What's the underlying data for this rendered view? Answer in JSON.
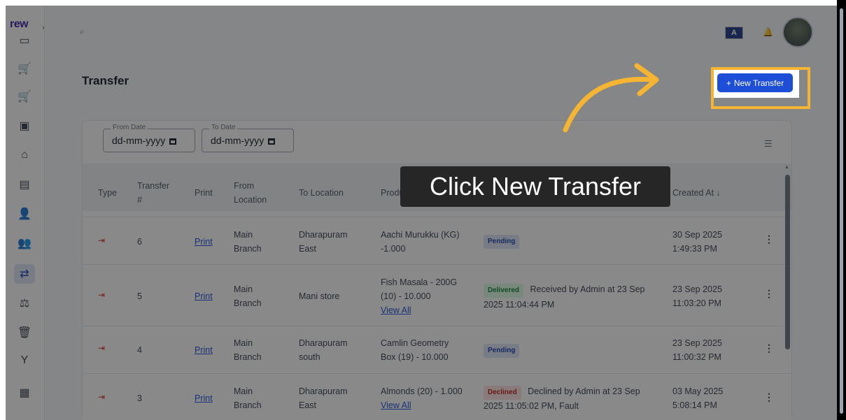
{
  "app": {
    "logo_text": "rew",
    "expand_chevron": "›"
  },
  "topbar": {
    "search_icon": "search-icon",
    "flag_label": "A",
    "bell_icon": "bell-icon"
  },
  "page": {
    "title": "Transfer",
    "new_transfer_label": "New Transfer",
    "new_transfer_plus": "+"
  },
  "filters": {
    "from_date_legend": "From Date",
    "from_date_value": "dd-mm-yyyy",
    "to_date_legend": "To Date",
    "to_date_value": "dd-mm-yyyy"
  },
  "table": {
    "headers": {
      "type": "Type",
      "transfer_no": "Transfer #",
      "print": "Print",
      "from_location": "From Location",
      "to_location": "To Location",
      "product": "Product (Qty)",
      "created_at": "Created At ↓"
    },
    "rows": [
      {
        "transfer_no": "6",
        "print": "Print",
        "from_l1": "Main",
        "from_l2": "Branch",
        "to_l1": "Dharapuram",
        "to_l2": "East",
        "prod_l1": "Aachi Murukku (KG)",
        "prod_l2": "-1.000",
        "prod_link": "",
        "badge": "Pending",
        "status_l1": "",
        "status_l2": "",
        "created_l1": "30 Sep 2025",
        "created_l2": "1:49:33 PM"
      },
      {
        "transfer_no": "5",
        "print": "Print",
        "from_l1": "Main",
        "from_l2": "Branch",
        "to_l1": "Mani store",
        "to_l2": "",
        "prod_l1": "Fish Masala - 200G",
        "prod_l2": "(10) - 10.000",
        "prod_link": "View All",
        "badge": "Delivered",
        "status_l1": "Received by Admin at 23 Sep",
        "status_l2": "2025 11:04:44 PM",
        "created_l1": "23 Sep 2025",
        "created_l2": "11:03:20 PM"
      },
      {
        "transfer_no": "4",
        "print": "Print",
        "from_l1": "Main",
        "from_l2": "Branch",
        "to_l1": "Dharapuram",
        "to_l2": "south",
        "prod_l1": "Camlin Geometry",
        "prod_l2": "Box (19) - 10.000",
        "prod_link": "",
        "badge": "Pending",
        "status_l1": "",
        "status_l2": "",
        "created_l1": "23 Sep 2025",
        "created_l2": "11:00:32 PM"
      },
      {
        "transfer_no": "3",
        "print": "Print",
        "from_l1": "Main",
        "from_l2": "Branch",
        "to_l1": "Dharapuram",
        "to_l2": "East",
        "prod_l1": "Almonds (20) - 1.000",
        "prod_l2": "",
        "prod_link": "View All",
        "badge": "Declined",
        "status_l1": "Declined by Admin at 23 Sep",
        "status_l2": "2025 11:05:02 PM, Fault",
        "created_l1": "03 May 2025",
        "created_l2": "5:08:14 PM"
      }
    ]
  },
  "tooltip": {
    "text": "Click New Transfer"
  },
  "colors": {
    "accent": "#1d4ed8",
    "highlight": "#f5b431",
    "overlay": "#141414",
    "pending": "#1e40af",
    "delivered": "#15803d",
    "declined": "#b91c1c"
  }
}
